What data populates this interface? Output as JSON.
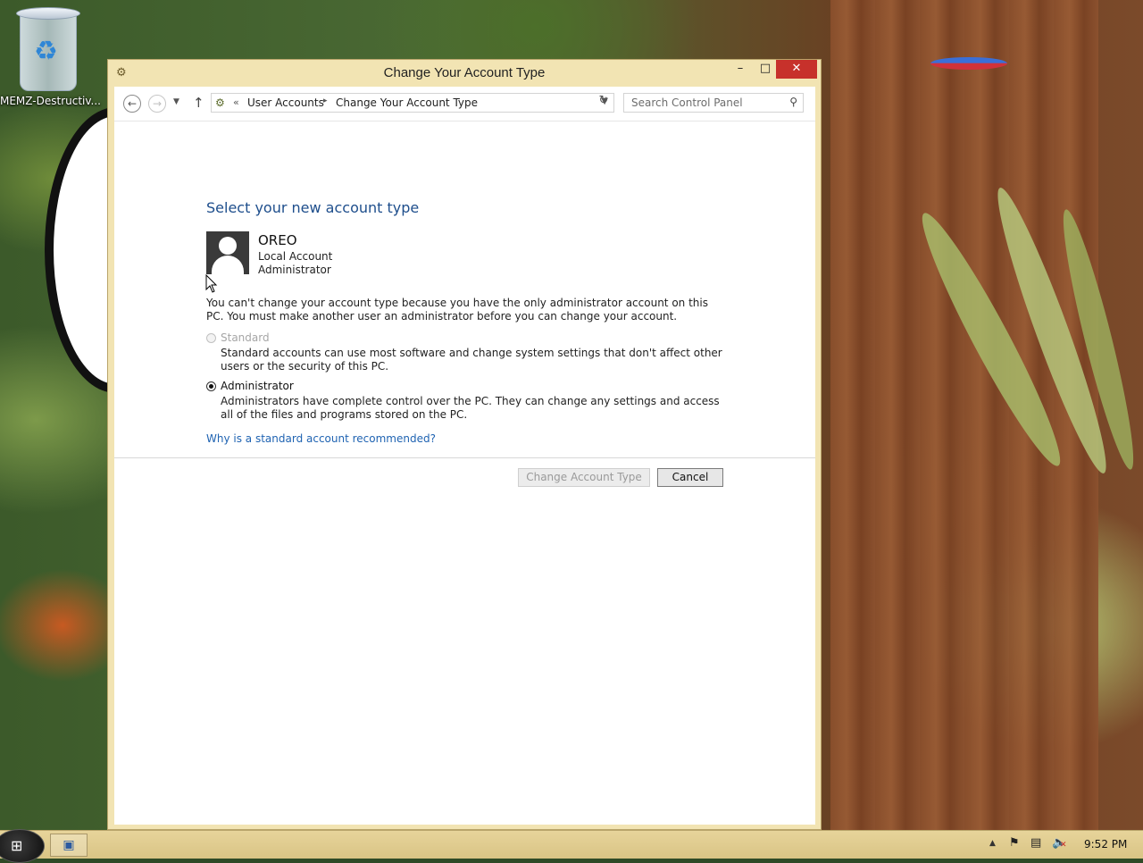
{
  "desktop": {
    "icons": [
      {
        "label": "MEMZ-Destructiv..."
      }
    ]
  },
  "window": {
    "title": "Change Your Account Type",
    "controls": {
      "minimize": "–",
      "maximize": "□",
      "close": "✕"
    },
    "address_bar": {
      "overflow_chevron": "«",
      "breadcrumbs": [
        "User Accounts",
        "Change Your Account Type"
      ],
      "separator": "▸"
    },
    "search": {
      "placeholder": "Search Control Panel"
    },
    "content": {
      "heading": "Select your new account type",
      "account": {
        "name": "OREO",
        "type": "Local Account",
        "role": "Administrator"
      },
      "notice": "You can't change your account type because you have the only administrator account on this PC. You must make another user an administrator before you can change your account.",
      "options": [
        {
          "label": "Standard",
          "description": "Standard accounts can use most software and change system settings that don't affect other users or the security of this PC.",
          "selected": false,
          "disabled": true
        },
        {
          "label": "Administrator",
          "description": "Administrators have complete control over the PC. They can change any settings and access all of the files and programs stored on the PC.",
          "selected": true,
          "disabled": false
        }
      ],
      "help_link": "Why is a standard account recommended?",
      "buttons": {
        "change": "Change Account Type",
        "cancel": "Cancel"
      }
    }
  },
  "taskbar": {
    "clock": "9:52 PM"
  },
  "colors": {
    "accent_heading": "#1e4e8c",
    "link": "#1f63b2",
    "window_frame": "#f2e4b3",
    "close_button": "#c7312b",
    "taskbar": "#e0cd91"
  },
  "icons": {
    "recycle_bin": "recycle-bin-icon",
    "back": "back-arrow-icon",
    "forward": "forward-arrow-icon",
    "up": "up-arrow-icon",
    "refresh": "refresh-icon",
    "search": "magnifier-icon",
    "start": "windows-logo-icon",
    "flag": "action-center-flag-icon",
    "network": "network-icon",
    "volume": "volume-muted-icon"
  }
}
